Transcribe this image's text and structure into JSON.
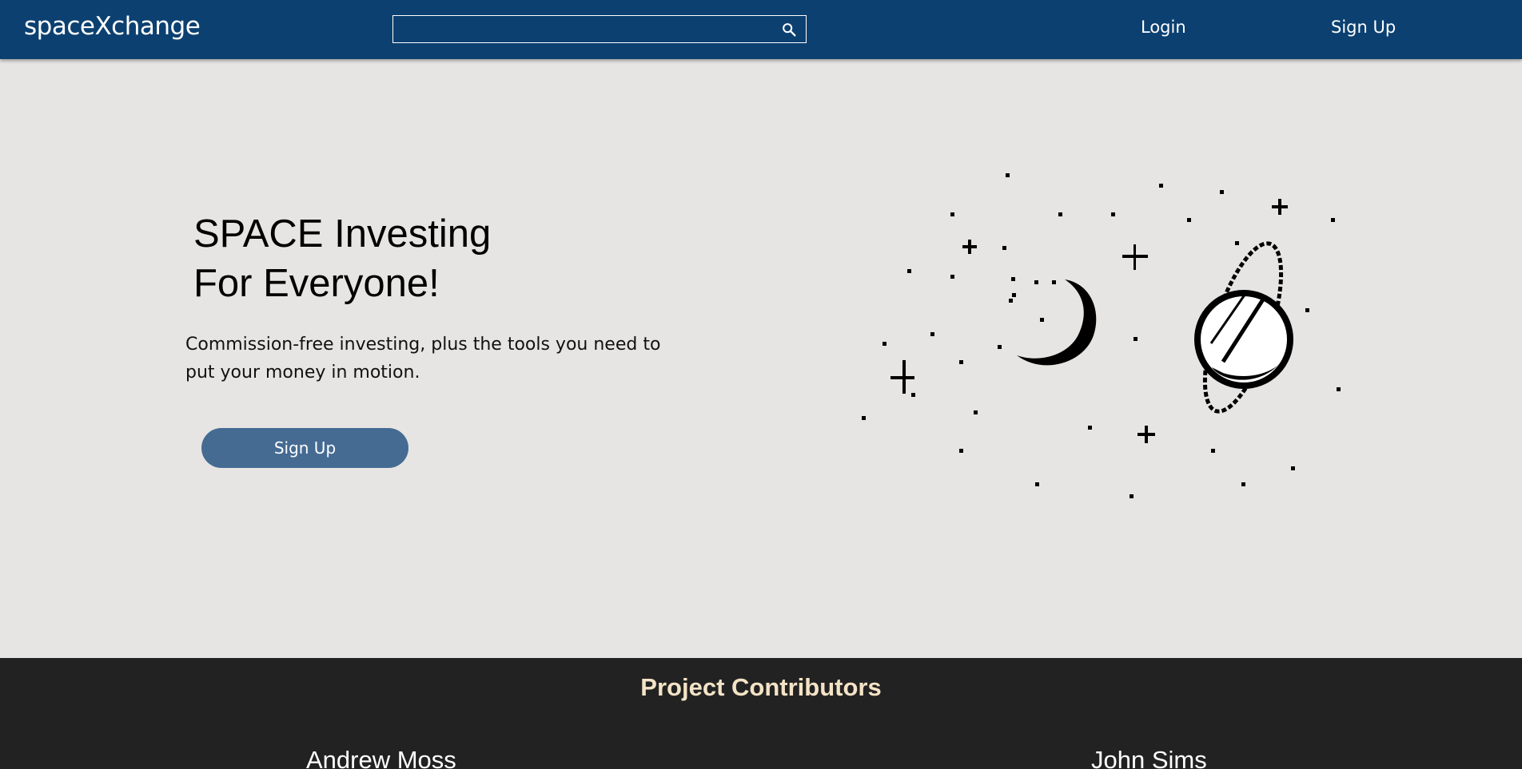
{
  "header": {
    "brand": "spaceXchange",
    "search": {
      "value": "",
      "placeholder": ""
    },
    "nav": {
      "login": "Login",
      "signup": "Sign Up"
    }
  },
  "hero": {
    "title_line1": "SPACE Investing",
    "title_line2": "For Everyone!",
    "description": "Commission-free investing, plus the tools you need to put your money in motion.",
    "cta_label": "Sign Up",
    "illustration_icon": "space-moon-planet-illustration"
  },
  "footer": {
    "title": "Project Contributors",
    "contributors": [
      "Andrew Moss",
      "John Sims"
    ]
  },
  "colors": {
    "navbar": "#0c4071",
    "page_background": "#e6e5e3",
    "button": "#456b93",
    "footer": "#222222",
    "footer_title": "#f4e3c6"
  }
}
